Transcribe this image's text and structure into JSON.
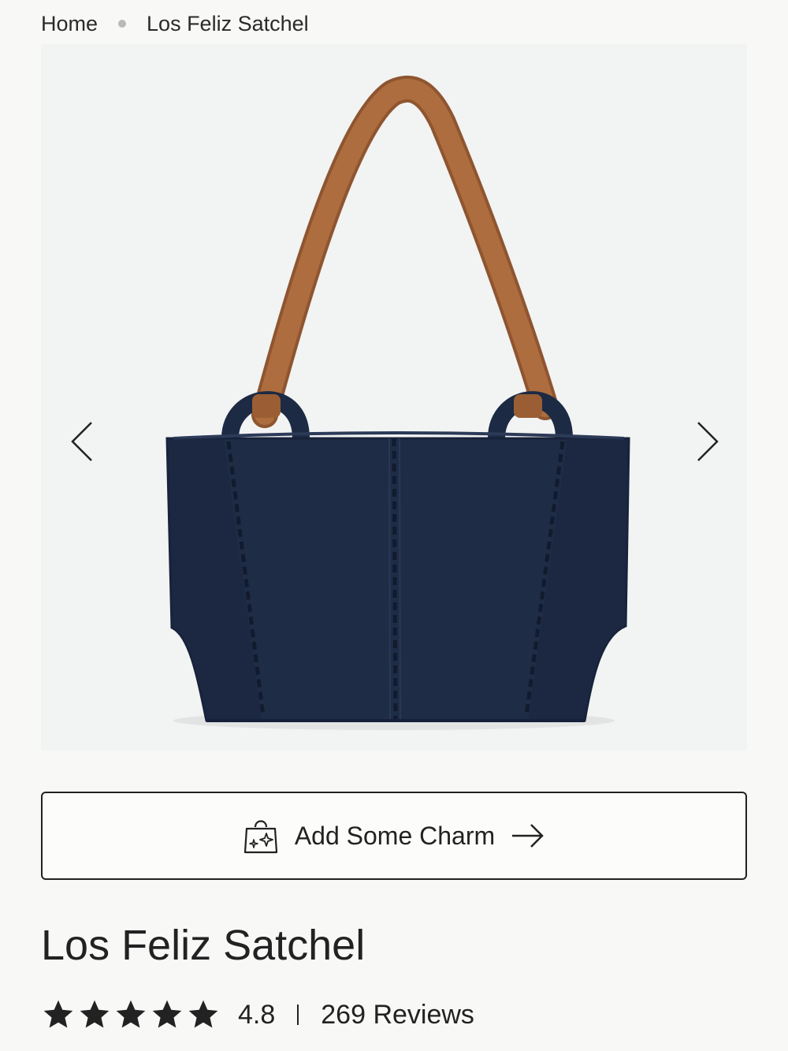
{
  "breadcrumb": {
    "home": "Home",
    "current": "Los Feliz Satchel"
  },
  "gallery": {
    "image_alt": "Los Feliz Satchel navy leather tote with brown straps",
    "prev_icon": "chevron-left-icon",
    "next_icon": "chevron-right-icon"
  },
  "charm_button": {
    "label": "Add Some Charm",
    "icon": "sparkle-bag-icon",
    "trailing_icon": "arrow-right-icon"
  },
  "product": {
    "title": "Los Feliz Satchel",
    "rating": "4.8",
    "rating_value": 4.8,
    "stars_filled": 5,
    "reviews": "269 Reviews"
  },
  "colors": {
    "background": "#f8f8f7",
    "bag_body": "#1e2b45",
    "strap": "#a9683a",
    "text": "#222222"
  }
}
